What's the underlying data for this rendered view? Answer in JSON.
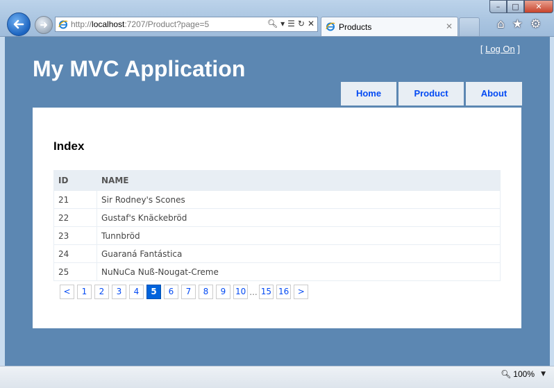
{
  "browser": {
    "address": {
      "scheme": "http://",
      "host": "localhost",
      "rest": ":7207/Product?page=5"
    },
    "tab_title": "Products",
    "zoom": "100%"
  },
  "site": {
    "logon_open": "[",
    "logon_link": "Log On",
    "logon_close": "]",
    "title": "My MVC Application",
    "menu": [
      {
        "label": "Home"
      },
      {
        "label": "Product"
      },
      {
        "label": "About"
      }
    ]
  },
  "main": {
    "heading": "Index",
    "table": {
      "columns": [
        "ID",
        "NAME"
      ],
      "rows": [
        {
          "id": "21",
          "name": "Sir Rodney's Scones"
        },
        {
          "id": "22",
          "name": "Gustaf's Knäckebröd"
        },
        {
          "id": "23",
          "name": "Tunnbröd"
        },
        {
          "id": "24",
          "name": "Guaraná Fantástica"
        },
        {
          "id": "25",
          "name": "NuNuCa Nuß-Nougat-Creme"
        }
      ]
    },
    "pager": {
      "prev": "<",
      "pages": [
        "1",
        "2",
        "3",
        "4",
        "5",
        "6",
        "7",
        "8",
        "9",
        "10"
      ],
      "current": "5",
      "ellipsis": "...",
      "last_pages": [
        "15",
        "16"
      ],
      "next": ">"
    }
  },
  "colors": {
    "page_bg": "#5c87b2",
    "link": "#034af3",
    "current_page": "#0063dc",
    "menu_bg": "#e8eef4"
  }
}
